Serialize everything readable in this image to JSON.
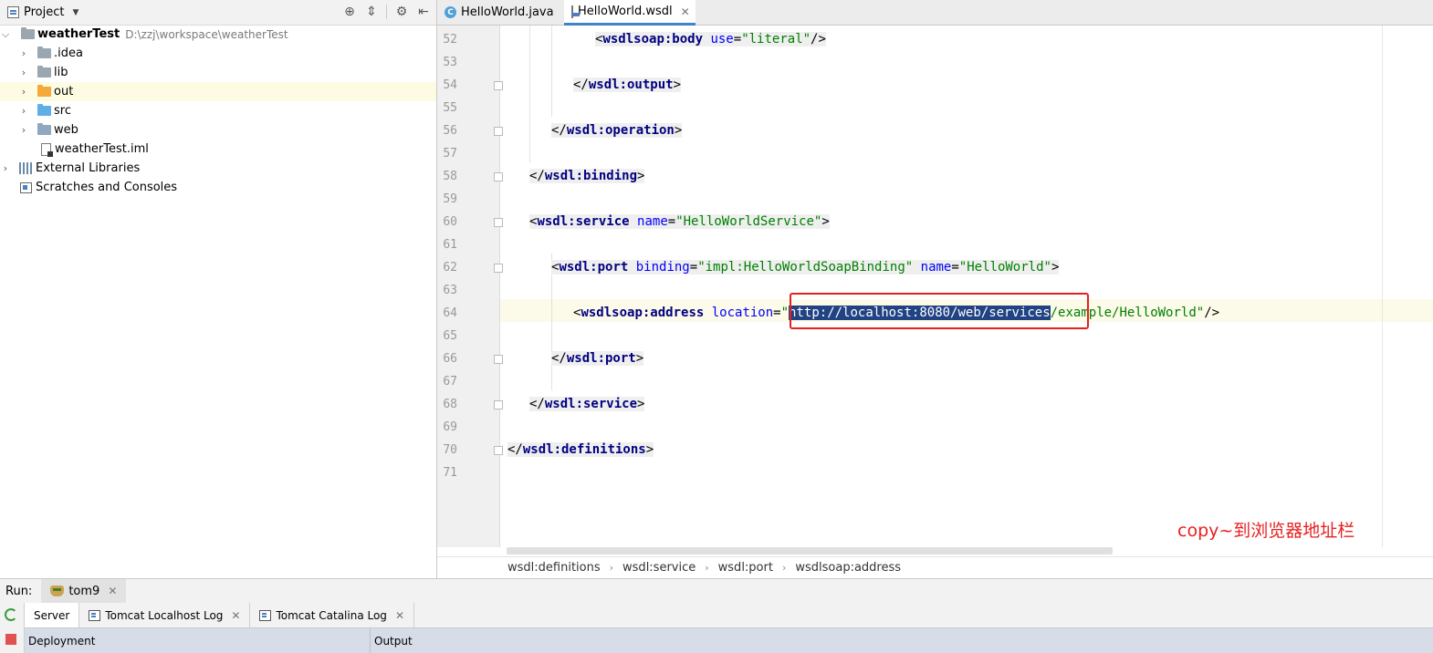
{
  "project_panel": {
    "title": "Project",
    "tree": [
      {
        "label": "weatherTest",
        "path": "D:\\zzj\\workspace\\weatherTest",
        "type": "module"
      },
      {
        "label": ".idea",
        "type": "folder"
      },
      {
        "label": "lib",
        "type": "folder"
      },
      {
        "label": "out",
        "type": "folder",
        "selected": true
      },
      {
        "label": "src",
        "type": "folder"
      },
      {
        "label": "web",
        "type": "folder"
      },
      {
        "label": "weatherTest.iml",
        "type": "file"
      },
      {
        "label": "External Libraries",
        "type": "libraries"
      },
      {
        "label": "Scratches and Consoles",
        "type": "scratches"
      }
    ]
  },
  "editor": {
    "tabs": [
      {
        "label": "HelloWorld.java",
        "active": false
      },
      {
        "label": "HelloWorld.wsdl",
        "active": true
      }
    ],
    "line_numbers": [
      "52",
      "53",
      "54",
      "55",
      "56",
      "57",
      "58",
      "59",
      "60",
      "61",
      "62",
      "63",
      "64",
      "65",
      "66",
      "67",
      "68",
      "69",
      "70",
      "71"
    ],
    "code": {
      "l52_tag": "wsdlsoap:body",
      "l52_attr": "use",
      "l52_val": "\"literal\"",
      "l54_tag": "wsdl:output",
      "l56_tag": "wsdl:operation",
      "l58_tag": "wsdl:binding",
      "l60_tag": "wsdl:service",
      "l60_attr": "name",
      "l60_val": "\"HelloWorldService\"",
      "l62_tag": "wsdl:port",
      "l62_attr1": "binding",
      "l62_val1": "\"impl:HelloWorldSoapBinding\"",
      "l62_attr2": "name",
      "l62_val2": "\"HelloWorld\"",
      "l64_tag": "wsdlsoap:address",
      "l64_attr": "location",
      "l64_q": "\"",
      "l64_selected": "http://localhost:8080/web/services",
      "l64_rest": "/example/HelloWorld\"",
      "l66_tag": "wsdl:port",
      "l68_tag": "wsdl:service",
      "l70_tag": "wsdl:definitions"
    },
    "annotation": "copy~到浏览器地址栏",
    "breadcrumb": [
      "wsdl:definitions",
      "wsdl:service",
      "wsdl:port",
      "wsdlsoap:address"
    ]
  },
  "run_panel": {
    "label": "Run:",
    "config": "tom9",
    "tabs": [
      "Server",
      "Tomcat Localhost Log",
      "Tomcat Catalina Log"
    ],
    "columns": [
      "Deployment",
      "Output"
    ]
  }
}
